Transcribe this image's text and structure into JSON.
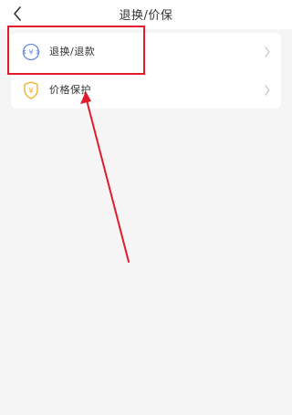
{
  "header": {
    "title": "退换/价保",
    "back_icon": "chevron-left-icon"
  },
  "menu": {
    "items": [
      {
        "label": "退换/退款",
        "icon": "exchange-refund-icon",
        "icon_color": "#4a74d9"
      },
      {
        "label": "价格保护",
        "icon": "price-protect-shield-icon",
        "icon_color": "#f0b429"
      }
    ],
    "chevron_icon": "chevron-right-icon"
  },
  "annotation": {
    "highlight_color": "#e01b2b",
    "arrow_color": "#e01b2b"
  }
}
